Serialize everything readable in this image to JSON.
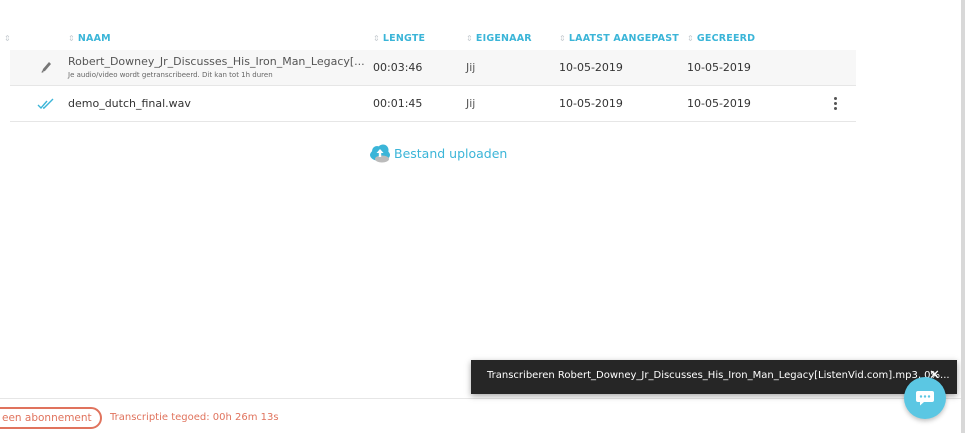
{
  "table": {
    "headers": {
      "naam": "NAAM",
      "lengte": "LENGTE",
      "eigenaar": "EIGENAAR",
      "laatst_aangepast": "LAATST AANGEPAST",
      "gecreeerd": "GECREERD"
    },
    "rows": [
      {
        "name": "Robert_Downey_Jr_Discusses_His_Iron_Man_Legacy[...",
        "subtitle": "Je audio/video wordt getranscribeerd. Dit kan tot 1h duren",
        "length": "00:03:46",
        "owner": "Jij",
        "modified": "10-05-2019",
        "created": "10-05-2019",
        "status_icon": "pencil-icon"
      },
      {
        "name": "demo_dutch_final.wav",
        "length": "00:01:45",
        "owner": "Jij",
        "modified": "10-05-2019",
        "created": "10-05-2019",
        "status_icon": "double-check-icon"
      }
    ]
  },
  "upload": {
    "label": "Bestand uploaden",
    "icon": "cloud-upload-icon"
  },
  "footer": {
    "subscription_label": "een abonnement",
    "credit_label": "Transcriptie tegoed: 00h 26m 13s"
  },
  "toast": {
    "message": "Transcriberen Robert_Downey_Jr_Discusses_His_Iron_Man_Legacy[ListenVid.com].mp3, 0%...",
    "close_icon": "close-icon"
  },
  "chat": {
    "icon": "chat-bubble-icon"
  },
  "colors": {
    "accent": "#3bb5d8",
    "warning": "#e0735d",
    "toast_bg": "#262626",
    "chat_bg": "#5bc7e3"
  }
}
